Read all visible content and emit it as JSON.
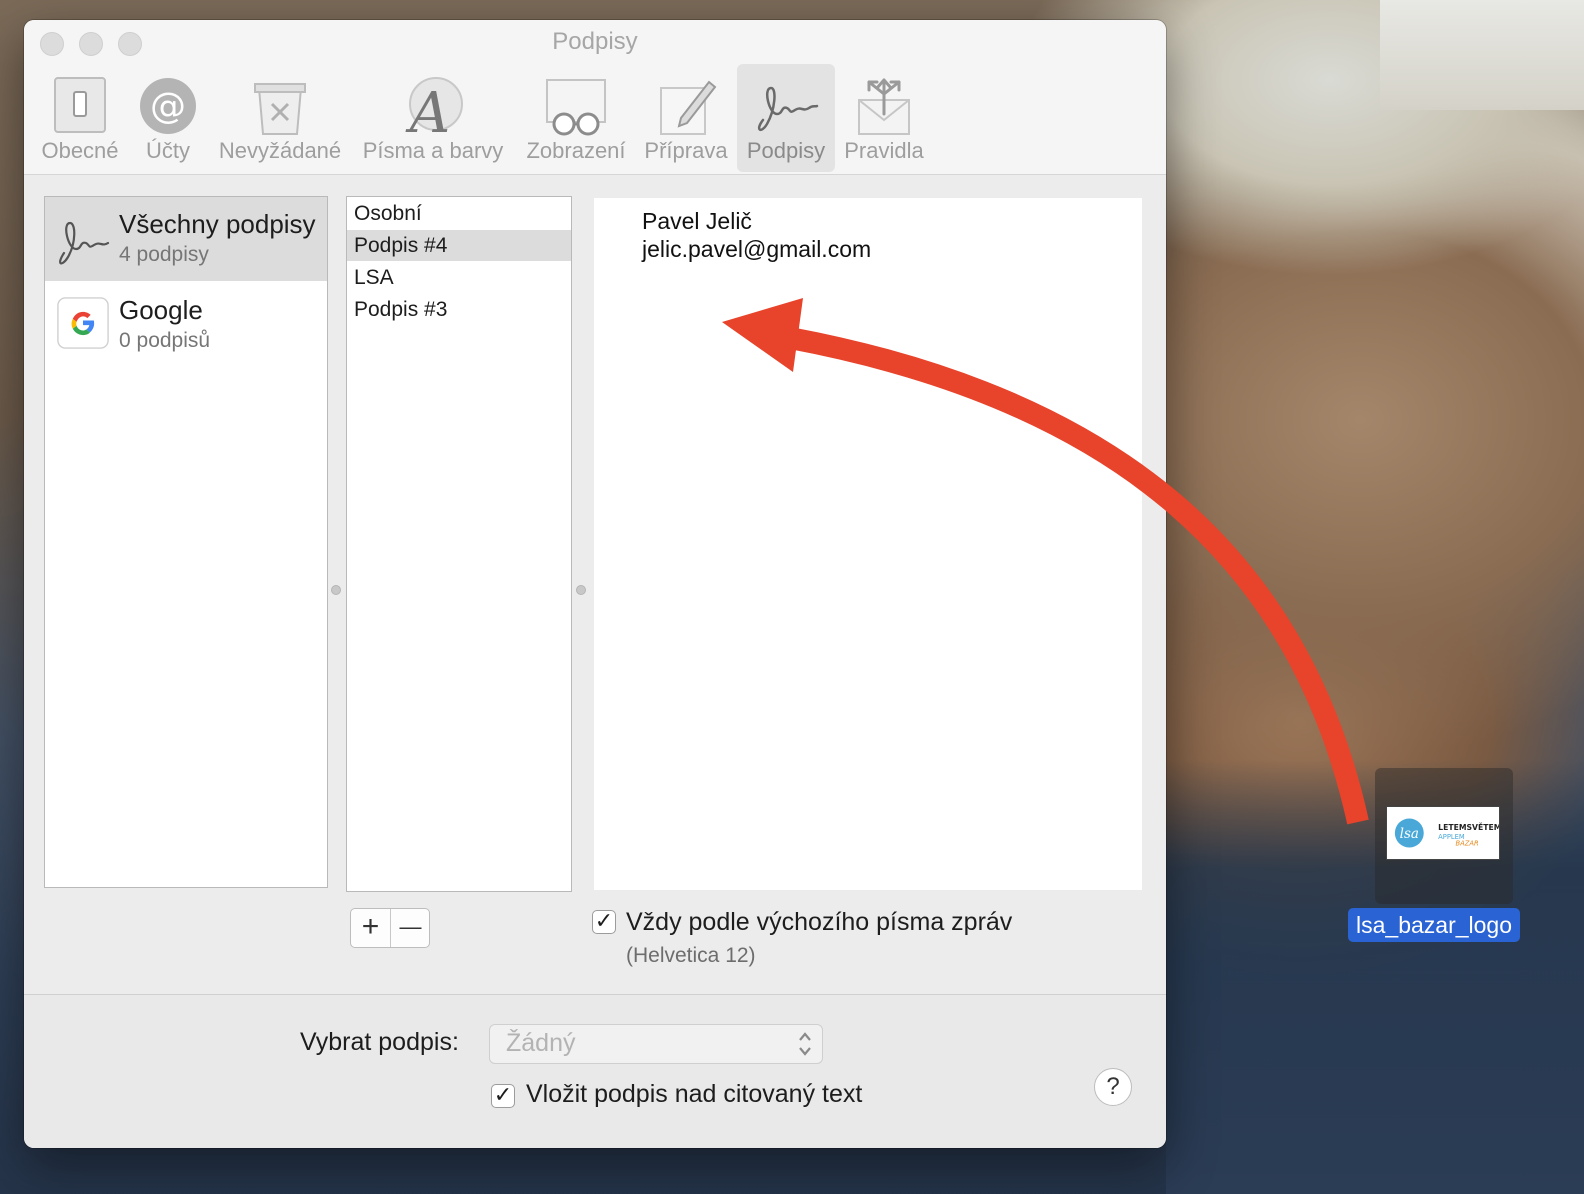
{
  "window": {
    "title": "Podpisy"
  },
  "toolbar": {
    "items": [
      {
        "label": "Obecné",
        "icon": "switch-icon"
      },
      {
        "label": "Účty",
        "icon": "at-sign-icon"
      },
      {
        "label": "Nevyžádané",
        "icon": "junk-trash-icon"
      },
      {
        "label": "Písma a barvy",
        "icon": "font-a-icon"
      },
      {
        "label": "Zobrazení",
        "icon": "glasses-icon"
      },
      {
        "label": "Příprava",
        "icon": "pencil-icon"
      },
      {
        "label": "Podpisy",
        "icon": "signature-icon"
      },
      {
        "label": "Pravidla",
        "icon": "rules-envelope-icon"
      }
    ],
    "active": "Podpisy"
  },
  "accounts": [
    {
      "name": "Všechny podpisy",
      "count": "4 podpisy",
      "icon": "signature-icon"
    },
    {
      "name": "Google",
      "count": "0 podpisů",
      "icon": "google-icon"
    }
  ],
  "signatures": [
    "Osobní",
    "Podpis #4",
    "LSA",
    "Podpis #3"
  ],
  "selected_signature": "Podpis #4",
  "editor": {
    "lines": [
      "Pavel Jelič",
      "jelic.pavel@gmail.com"
    ]
  },
  "buttons": {
    "add": "+",
    "remove": "—"
  },
  "font_option": {
    "label": "Vždy podle výchozího písma zpráv",
    "sub": "(Helvetica 12)",
    "checked": true
  },
  "choose_signature": {
    "label": "Vybrat podpis:",
    "value": "Žádný"
  },
  "place_above": {
    "label": "Vložit podpis nad citovaný text",
    "checked": true
  },
  "help": "?",
  "desktop_file": {
    "name": "lsa_bazar_logo",
    "thumb_text": [
      "LETEMSVĚTEM",
      "APPLEM",
      "BAZAR"
    ]
  },
  "colors": {
    "arrow": "#e8432b",
    "selection": "#dcdcdc",
    "file_label_bg": "#2a63d4"
  }
}
